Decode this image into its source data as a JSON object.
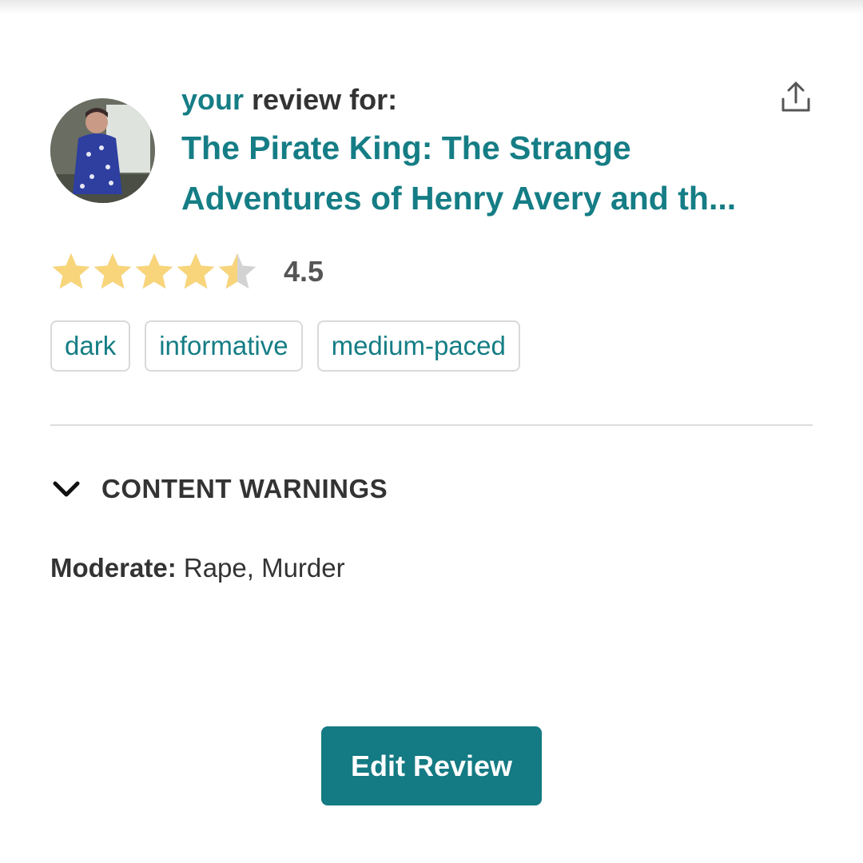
{
  "header": {
    "your_label": "your",
    "review_for_label": " review for:",
    "book_title": "The Pirate King: The Strange Adventures of Henry Avery and th...",
    "share_icon": "share-icon"
  },
  "rating": {
    "value": 4.5,
    "max": 5,
    "display": "4.5",
    "star_color": "#f8d57a",
    "empty_star_color": "#d3d3d3"
  },
  "tags": [
    "dark",
    "informative",
    "medium-paced"
  ],
  "content_warnings": {
    "section_title": "CONTENT WARNINGS",
    "toggle_icon": "chevron-down-icon",
    "level_label": "Moderate:",
    "items_text": " Rape, Murder"
  },
  "actions": {
    "edit_label": "Edit Review"
  },
  "colors": {
    "accent": "#157d85",
    "button_bg": "#147a83",
    "text": "#333333"
  }
}
